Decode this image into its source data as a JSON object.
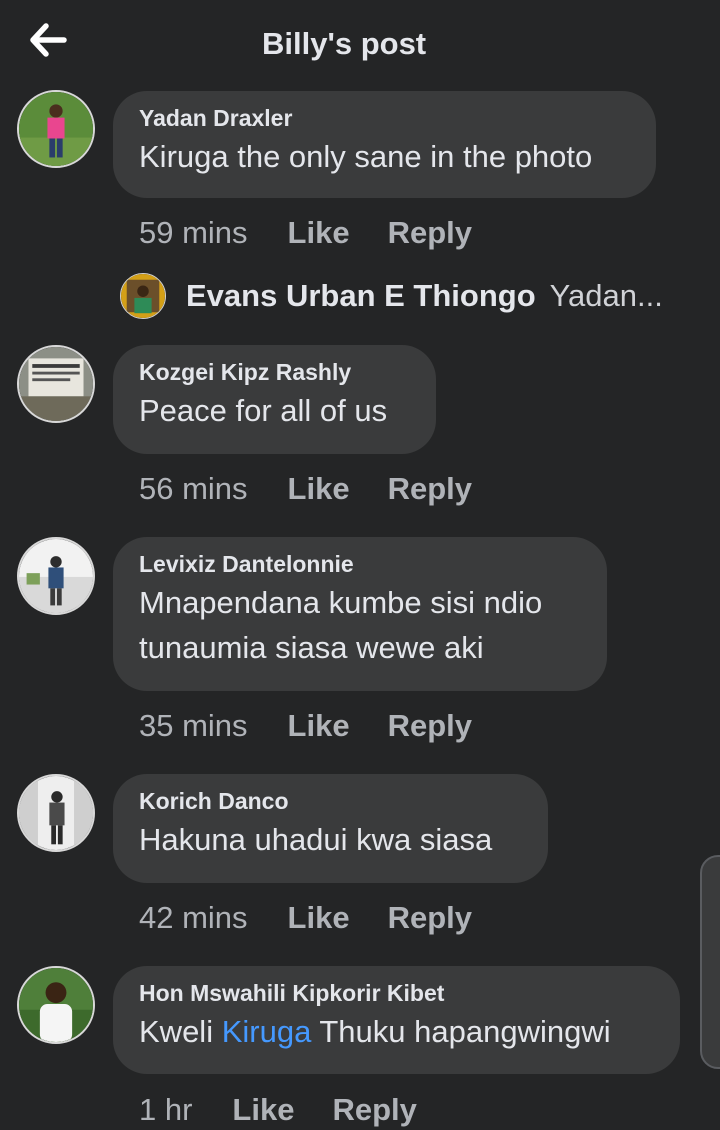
{
  "header": {
    "title": "Billy's post"
  },
  "colors": {
    "background": "#242526",
    "bubble": "#3a3b3c",
    "mention": "#4599ff",
    "meta": "#b0b3b8"
  },
  "comments": [
    {
      "author": "Yadan Draxler",
      "text": "Kiruga the only sane in the photo",
      "time": "59 mins",
      "like": "Like",
      "reply": "Reply"
    },
    {
      "author": "Kozgei Kipz Rashly",
      "text": "Peace for all of us",
      "time": "56 mins",
      "like": "Like",
      "reply": "Reply"
    },
    {
      "author": "Levixiz Dantelonnie",
      "text_line1": "Mnapendana kumbe sisi ndio",
      "text_line2": "tunaumia siasa wewe aki",
      "time": "35 mins",
      "like": "Like",
      "reply": "Reply"
    },
    {
      "author": "Korich Danco",
      "text": "Hakuna uhadui kwa siasa",
      "time": "42 mins",
      "like": "Like",
      "reply": "Reply"
    },
    {
      "author": "Hon Mswahili Kipkorir Kibet",
      "text_prefix": "Kweli ",
      "mention": "Kiruga",
      "text_suffix": " Thuku hapangwingwi",
      "time": "1 hr",
      "like": "Like",
      "reply": "Reply"
    }
  ],
  "reply_preview": {
    "name": "Evans Urban E Thiongo",
    "snippet": "Yadan..."
  }
}
